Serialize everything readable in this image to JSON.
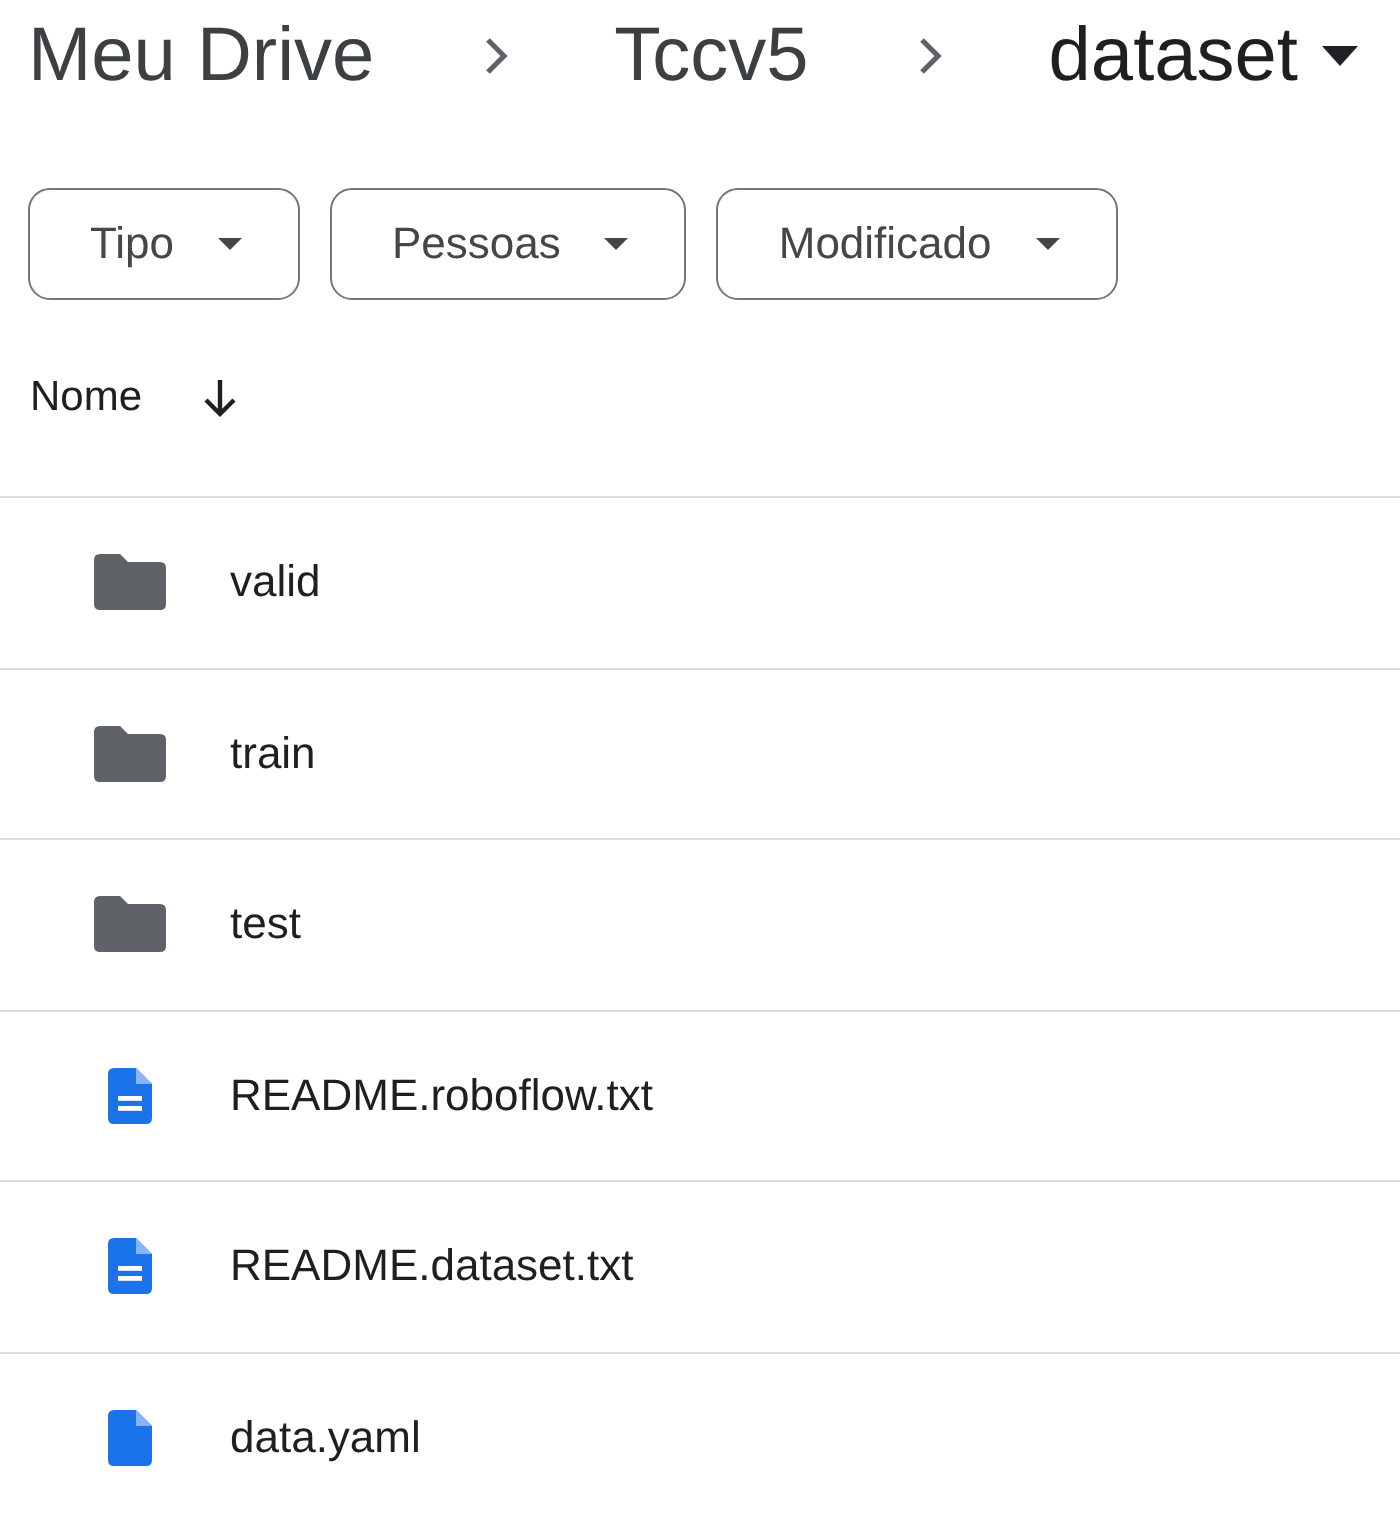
{
  "breadcrumb": [
    {
      "label": "Meu Drive"
    },
    {
      "label": "Tccv5"
    },
    {
      "label": "dataset",
      "dropdown": true
    }
  ],
  "filters": [
    {
      "label": "Tipo"
    },
    {
      "label": "Pessoas"
    },
    {
      "label": "Modificado"
    }
  ],
  "table": {
    "columns": [
      {
        "label": "Nome",
        "sort_descending": true
      }
    ],
    "rows": [
      {
        "kind": "folder",
        "name": "valid"
      },
      {
        "kind": "folder",
        "name": "train"
      },
      {
        "kind": "folder",
        "name": "test"
      },
      {
        "kind": "document",
        "name": "README.roboflow.txt"
      },
      {
        "kind": "document",
        "name": "README.dataset.txt"
      },
      {
        "kind": "file",
        "name": "data.yaml"
      }
    ]
  }
}
